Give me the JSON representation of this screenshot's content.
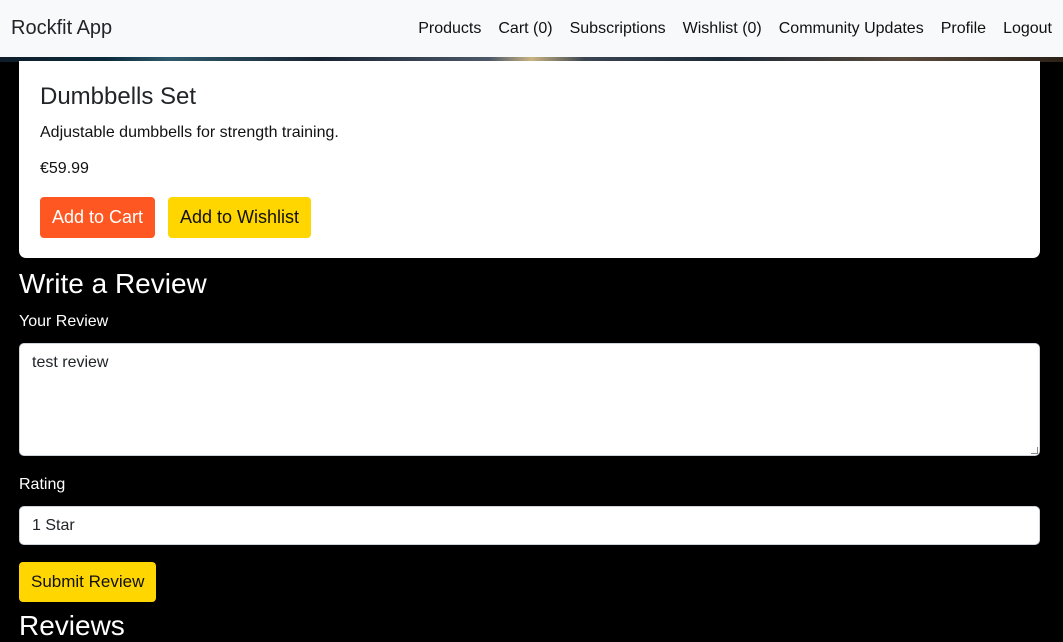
{
  "navbar": {
    "brand": "Rockfit App",
    "links": [
      {
        "label": "Products"
      },
      {
        "label": "Cart (0)"
      },
      {
        "label": "Subscriptions"
      },
      {
        "label": "Wishlist (0)"
      },
      {
        "label": "Community Updates"
      },
      {
        "label": "Profile"
      },
      {
        "label": "Logout"
      }
    ]
  },
  "product": {
    "title": "Dumbbells Set",
    "description": "Adjustable dumbbells for strength training.",
    "price": "€59.99",
    "add_to_cart_label": "Add to Cart",
    "add_to_wishlist_label": "Add to Wishlist"
  },
  "review_form": {
    "heading": "Write a Review",
    "review_label": "Your Review",
    "review_value": "test review",
    "rating_label": "Rating",
    "rating_selected": "1 Star",
    "submit_label": "Submit Review"
  },
  "reviews": {
    "heading": "Reviews"
  },
  "colors": {
    "navbar_bg": "#f8f9fa",
    "page_bg": "#000000",
    "cart_button": "#ff5722",
    "wishlist_button": "#ffd600",
    "submit_button": "#ffd600"
  }
}
